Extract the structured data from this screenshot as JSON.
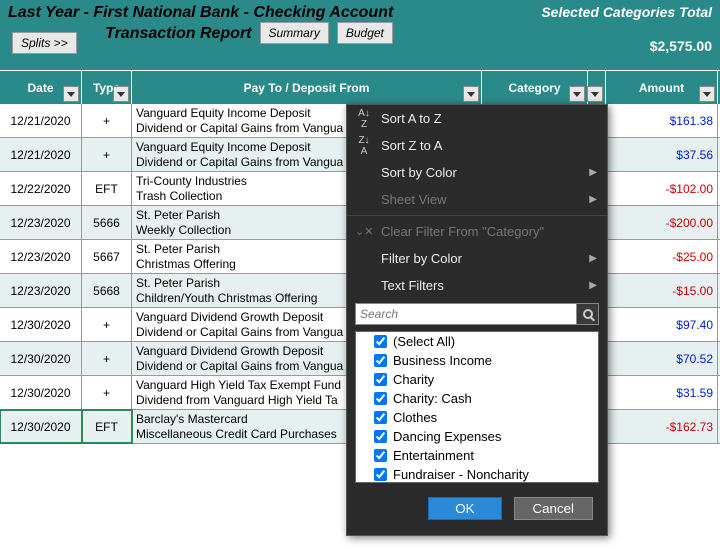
{
  "header": {
    "title_line1": "Last Year - First National Bank - Checking Account",
    "title_line2": "Transaction Report",
    "splits_label": "Splits >>",
    "summary_label": "Summary",
    "budget_label": "Budget",
    "selected_label": "Selected Categories Total",
    "selected_amount": "$2,575.00"
  },
  "columns": {
    "date": "Date",
    "type": "Type",
    "payto": "Pay To / Deposit From",
    "category": "Category",
    "check": "",
    "amount": "Amount"
  },
  "rows": [
    {
      "date": "12/21/2020",
      "type": "+",
      "pay1": "Vanguard Equity Income Deposit",
      "pay2": "Dividend or Capital Gains from Vangua",
      "check": "√",
      "amount": "$161.38",
      "neg": false,
      "alt": false
    },
    {
      "date": "12/21/2020",
      "type": "+",
      "pay1": "Vanguard Equity Income Deposit",
      "pay2": "Dividend or Capital Gains from Vangua",
      "check": "√",
      "amount": "$37.56",
      "neg": false,
      "alt": true
    },
    {
      "date": "12/22/2020",
      "type": "EFT",
      "pay1": "Tri-County Industries",
      "pay2": "Trash Collection",
      "check": "√",
      "amount": "-$102.00",
      "neg": true,
      "alt": false
    },
    {
      "date": "12/23/2020",
      "type": "5666",
      "pay1": "St. Peter Parish",
      "pay2": "Weekly Collection",
      "check": "√",
      "amount": "-$200.00",
      "neg": true,
      "alt": true
    },
    {
      "date": "12/23/2020",
      "type": "5667",
      "pay1": "St. Peter Parish",
      "pay2": "Christmas Offering",
      "check": "√",
      "amount": "-$25.00",
      "neg": true,
      "alt": false
    },
    {
      "date": "12/23/2020",
      "type": "5668",
      "pay1": "St. Peter Parish",
      "pay2": "Children/Youth Christmas Offering",
      "check": "√",
      "amount": "-$15.00",
      "neg": true,
      "alt": true
    },
    {
      "date": "12/30/2020",
      "type": "+",
      "pay1": "Vanguard Dividend Growth Deposit",
      "pay2": "Dividend or Capital Gains from Vangua",
      "check": "√",
      "amount": "$97.40",
      "neg": false,
      "alt": false
    },
    {
      "date": "12/30/2020",
      "type": "+",
      "pay1": "Vanguard Dividend Growth Deposit",
      "pay2": "Dividend or Capital Gains from Vangua",
      "check": "√",
      "amount": "$70.52",
      "neg": false,
      "alt": true
    },
    {
      "date": "12/30/2020",
      "type": "+",
      "pay1": "Vanguard High Yield Tax Exempt Fund",
      "pay2": "Dividend from Vanguard High Yield Ta",
      "check": "√",
      "amount": "$31.59",
      "neg": false,
      "alt": false
    },
    {
      "date": "12/30/2020",
      "type": "EFT",
      "pay1": "Barclay's Mastercard",
      "pay2": "Miscellaneous Credit Card Purchases",
      "check": "√",
      "amount": "-$162.73",
      "neg": true,
      "alt": true
    }
  ],
  "filter": {
    "sort_az": "Sort A to Z",
    "sort_za": "Sort Z to A",
    "sort_color": "Sort by Color",
    "sheet_view": "Sheet View",
    "clear_filter": "Clear Filter From \"Category\"",
    "filter_color": "Filter by Color",
    "text_filters": "Text Filters",
    "search_placeholder": "Search",
    "items": [
      "(Select All)",
      "Business Income",
      "Charity",
      "Charity: Cash",
      "Clothes",
      "Dancing Expenses",
      "Entertainment",
      "Fundraiser - Noncharity"
    ],
    "ok": "OK",
    "cancel": "Cancel"
  }
}
